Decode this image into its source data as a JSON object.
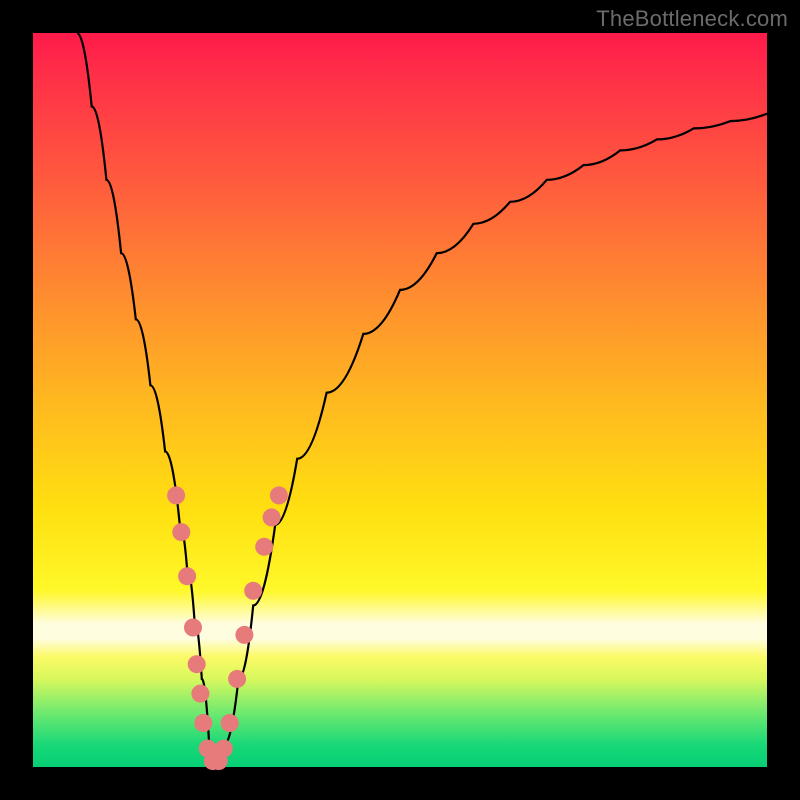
{
  "watermark": "TheBottleneck.com",
  "colors": {
    "frame": "#000000",
    "curve_stroke": "#000000",
    "marker_fill": "#e77a7a",
    "marker_stroke": "#d55c5c",
    "gradient_top": "#ff1a4a",
    "gradient_bottom": "#06cf74"
  },
  "chart_data": {
    "type": "line",
    "title": "",
    "xlabel": "",
    "ylabel": "",
    "xlim": [
      0,
      100
    ],
    "ylim": [
      0,
      100
    ],
    "grid": false,
    "legend": false,
    "note": "Axes are unlabeled in the image; values are read as percent of plot width/height. y=0 is the bottom (green) edge, y=100 is the top (red) edge. The curve is a V-shaped bottleneck trough.",
    "series": [
      {
        "name": "bottleneck-curve",
        "x": [
          6,
          8,
          10,
          12,
          14,
          16,
          18,
          20,
          21,
          22,
          23,
          24,
          25,
          26,
          28,
          30,
          33,
          36,
          40,
          45,
          50,
          55,
          60,
          65,
          70,
          75,
          80,
          85,
          90,
          95,
          100
        ],
        "y": [
          100,
          90,
          80,
          70,
          61,
          52,
          43,
          33,
          27,
          20,
          12,
          3,
          0,
          3,
          12,
          22,
          33,
          42,
          51,
          59,
          65,
          70,
          74,
          77,
          80,
          82,
          84,
          85.5,
          87,
          88,
          89
        ]
      }
    ],
    "markers": {
      "name": "highlighted-points",
      "note": "Pink rounded markers clustered near the trough on both branches.",
      "points": [
        {
          "x": 19.5,
          "y": 37
        },
        {
          "x": 20.2,
          "y": 32
        },
        {
          "x": 21.0,
          "y": 26
        },
        {
          "x": 21.8,
          "y": 19
        },
        {
          "x": 22.3,
          "y": 14
        },
        {
          "x": 22.8,
          "y": 10
        },
        {
          "x": 23.2,
          "y": 6
        },
        {
          "x": 23.8,
          "y": 2.5
        },
        {
          "x": 24.5,
          "y": 0.8
        },
        {
          "x": 25.3,
          "y": 0.8
        },
        {
          "x": 26.0,
          "y": 2.5
        },
        {
          "x": 26.8,
          "y": 6
        },
        {
          "x": 27.8,
          "y": 12
        },
        {
          "x": 28.8,
          "y": 18
        },
        {
          "x": 30.0,
          "y": 24
        },
        {
          "x": 31.5,
          "y": 30
        },
        {
          "x": 32.5,
          "y": 34
        },
        {
          "x": 33.5,
          "y": 37
        }
      ]
    }
  }
}
